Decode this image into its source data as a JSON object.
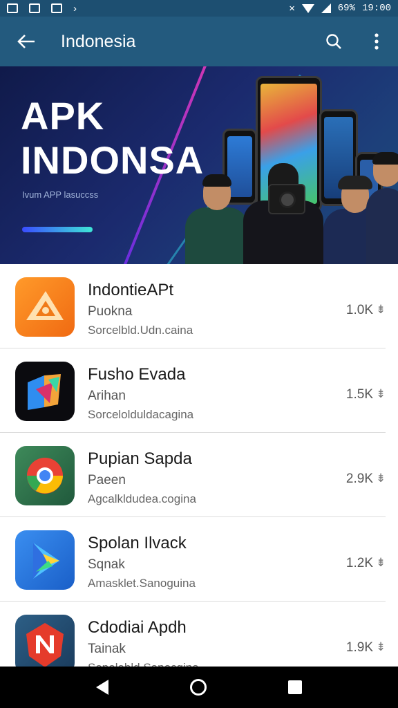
{
  "status_bar": {
    "time": "19:00",
    "battery": "69%"
  },
  "app_bar": {
    "title": "Indonesia"
  },
  "banner": {
    "headline_line1": "APK",
    "headline_line2": "INDONSA",
    "subtitle": "Ivum APP lasuccss"
  },
  "apps": [
    {
      "name": "IndontieAPt",
      "developer": "Puokna",
      "meta": "Sorcelbld.Udn.caina",
      "count": "1.0K"
    },
    {
      "name": "Fusho Evada",
      "developer": "Arihan",
      "meta": "Sorcelolduldacagina",
      "count": "1.5K"
    },
    {
      "name": "Pupian Sapda",
      "developer": "Paeen",
      "meta": "Agcalkldudea.cogina",
      "count": "2.9K"
    },
    {
      "name": "Spolan Ilvack",
      "developer": "Sqnak",
      "meta": "Amasklet.Sanoguina",
      "count": "1.2K"
    },
    {
      "name": "Cdodiai Apdh",
      "developer": "Tainak",
      "meta": "Sopolabld.Sanocgina",
      "count": "1.9K"
    }
  ],
  "colors": {
    "status_bar": "#1d4f71",
    "app_bar": "#235a7e"
  }
}
